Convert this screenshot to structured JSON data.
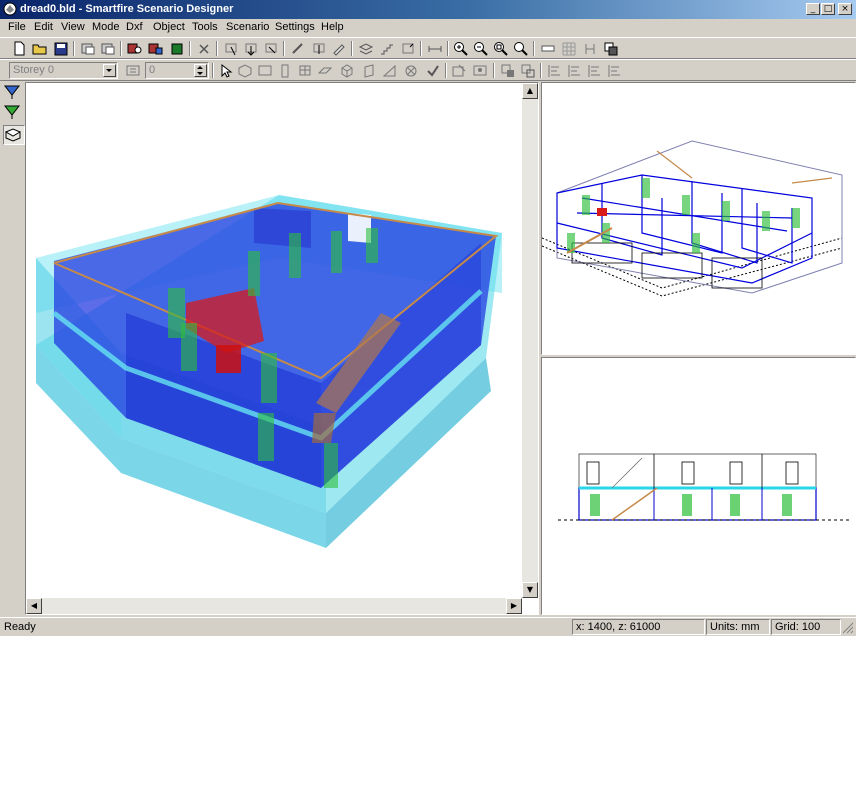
{
  "window": {
    "title": "dread0.bld - Smartfire Scenario Designer",
    "controls": [
      "minimize",
      "maximize",
      "close"
    ]
  },
  "menu": [
    {
      "label": "File",
      "name": "file"
    },
    {
      "label": "Edit",
      "name": "edit"
    },
    {
      "label": "View",
      "name": "view"
    },
    {
      "label": "Mode",
      "name": "mode"
    },
    {
      "label": "Dxf",
      "name": "dxf"
    },
    {
      "label": "Object",
      "name": "object"
    },
    {
      "label": "Tools",
      "name": "tools"
    },
    {
      "label": "Scenario",
      "name": "scenario"
    },
    {
      "label": "Settings",
      "name": "settings"
    },
    {
      "label": "Help",
      "name": "help"
    }
  ],
  "toolbar2": {
    "storey_value": "Storey 0",
    "number_value": "0"
  },
  "status": {
    "ready": "Ready",
    "coords": "x: 1400, z: 61000",
    "units": "Units: mm",
    "grid": "Grid: 100"
  },
  "colors": {
    "titlebar_start": "#0a246a",
    "titlebar_end": "#a6caf0",
    "chrome": "#d4d0c8",
    "walls_blue": "#1f35e0",
    "outer_cyan": "#4fd6e8",
    "doors_green": "#2dbf3a",
    "stairs_red": "#d81a1a",
    "stair_brown": "#c58a4a"
  }
}
